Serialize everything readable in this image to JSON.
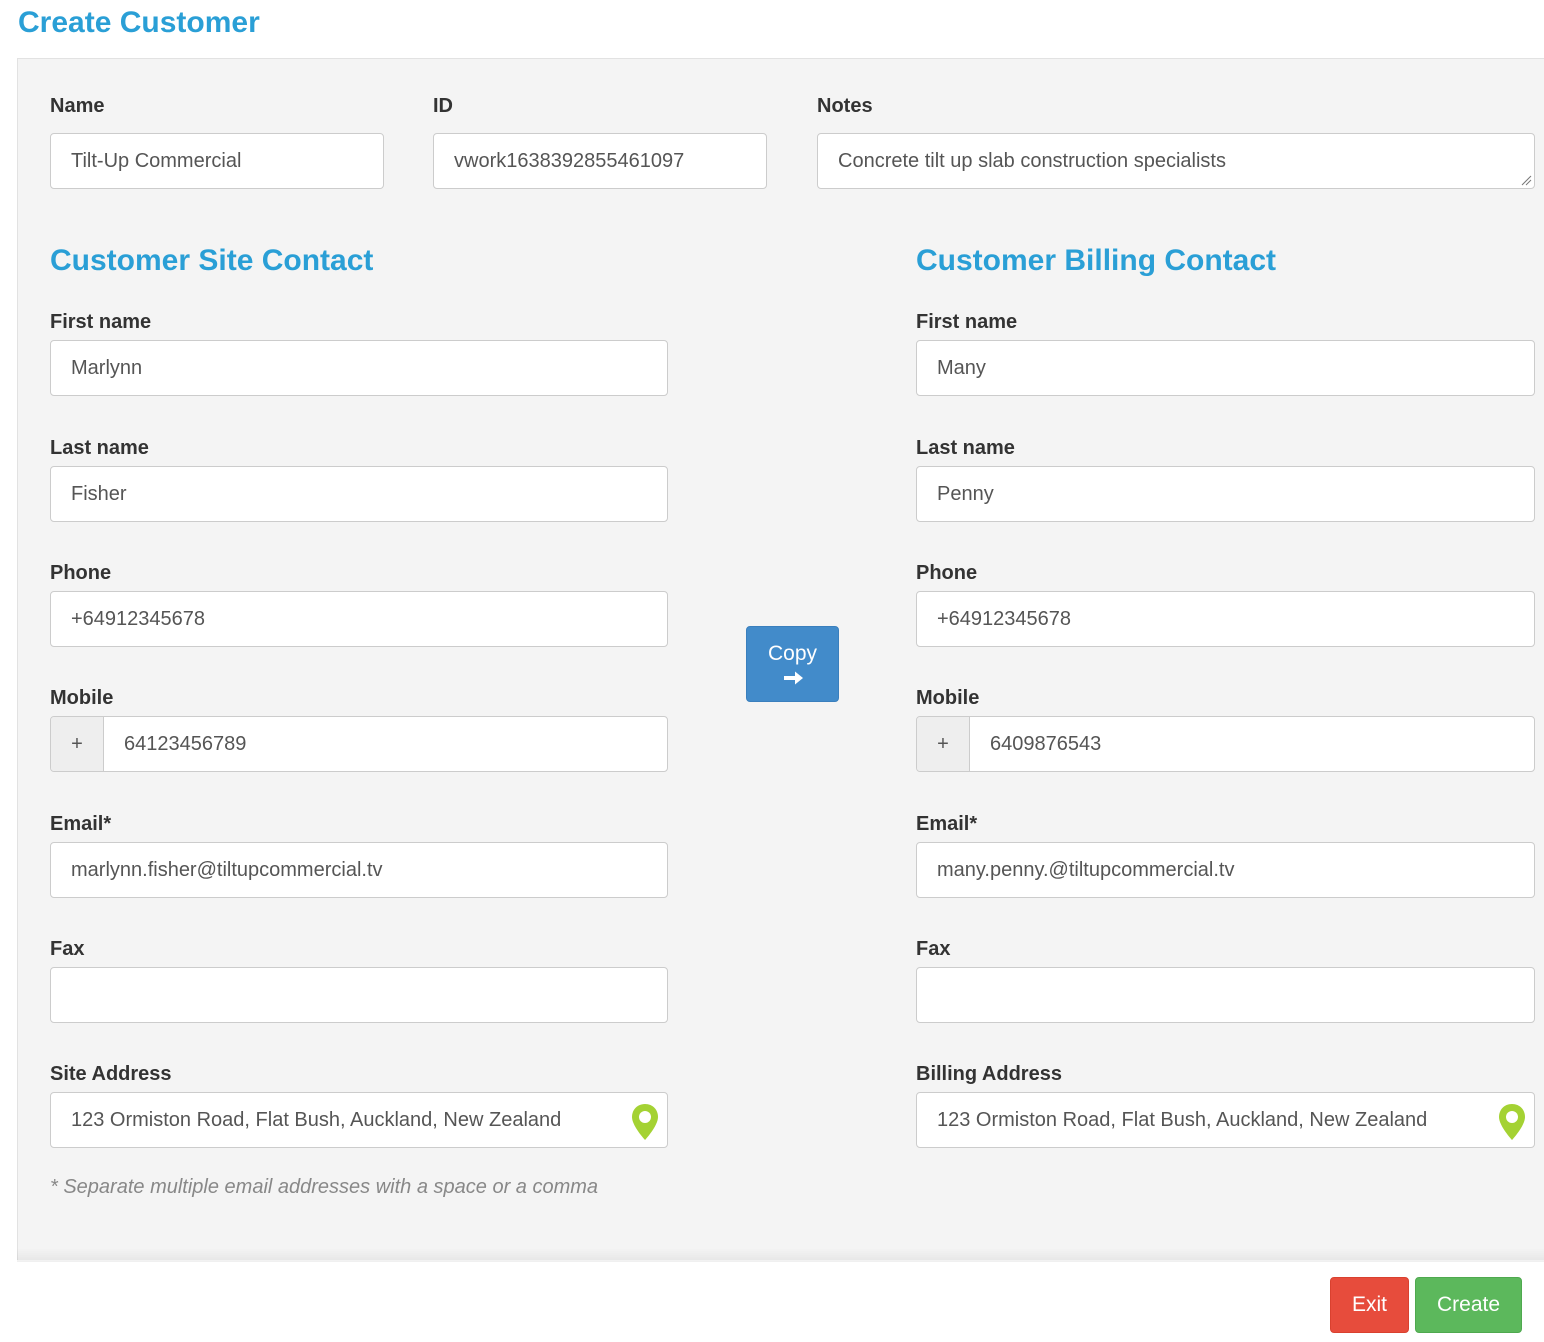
{
  "page": {
    "title": "Create Customer"
  },
  "customer": {
    "name_label": "Name",
    "name_value": "Tilt-Up Commercial",
    "id_label": "ID",
    "id_value": "vwork1638392855461097",
    "notes_label": "Notes",
    "notes_value": "Concrete tilt up slab construction specialists"
  },
  "site": {
    "title": "Customer Site Contact",
    "first_name_label": "First name",
    "first_name": "Marlynn",
    "last_name_label": "Last name",
    "last_name": "Fisher",
    "phone_label": "Phone",
    "phone": "+64912345678",
    "mobile_label": "Mobile",
    "mobile_prefix": "+",
    "mobile": "64123456789",
    "email_label": "Email*",
    "email": "marlynn.fisher@tiltupcommercial.tv",
    "fax_label": "Fax",
    "fax": "",
    "address_label": "Site Address",
    "address": "123 Ormiston Road, Flat Bush, Auckland, New Zealand"
  },
  "billing": {
    "title": "Customer Billing Contact",
    "first_name_label": "First name",
    "first_name": "Many",
    "last_name_label": "Last name",
    "last_name": "Penny",
    "phone_label": "Phone",
    "phone": "+64912345678",
    "mobile_label": "Mobile",
    "mobile_prefix": "+",
    "mobile": "6409876543",
    "email_label": "Email*",
    "email": "many.penny.@tiltupcommercial.tv",
    "fax_label": "Fax",
    "fax": "",
    "address_label": "Billing Address",
    "address": "123 Ormiston Road, Flat Bush, Auckland, New Zealand"
  },
  "copy_button": {
    "label": "Copy",
    "icon": "arrow-right-icon"
  },
  "hint": "* Separate multiple email addresses with a space or a comma",
  "footer": {
    "exit_label": "Exit",
    "create_label": "Create"
  },
  "colors": {
    "accent": "#2a9fd6",
    "copy": "#428bca",
    "exit": "#e74c3c",
    "create": "#5cb85c",
    "pin": "#a4d233"
  },
  "icons": {
    "address_pin": "map-pin-icon"
  }
}
